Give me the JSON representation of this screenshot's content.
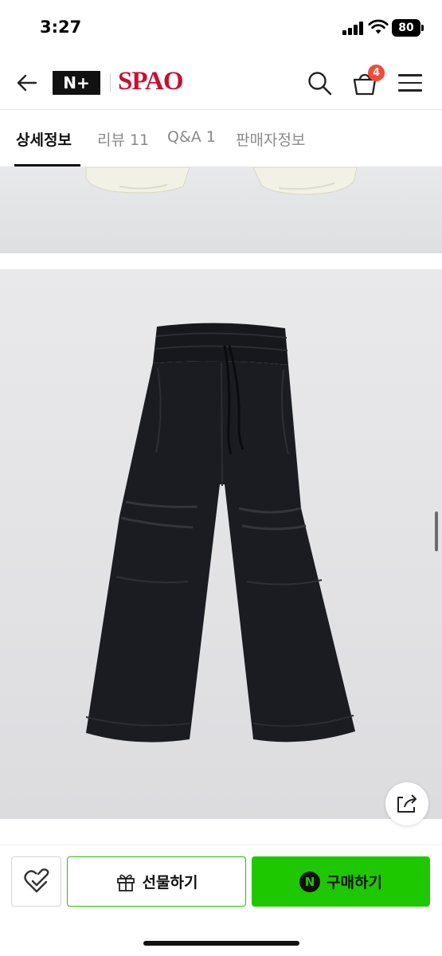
{
  "status_bar": {
    "time": "3:27",
    "battery": "80",
    "icons": [
      "signal-icon",
      "wifi-icon",
      "battery-icon"
    ]
  },
  "header": {
    "icons": [
      "back-arrow-icon",
      "search-icon",
      "shopping-bag-icon",
      "hamburger-menu-icon"
    ],
    "nplus_logo": "N+",
    "brand_logo": "SPAO",
    "cart_count": "4",
    "brand_color": "#c8102e",
    "badge_color": "#f04b3a"
  },
  "tabs": [
    {
      "label": "상세정보",
      "active": true
    },
    {
      "label": "리뷰 11",
      "active": false
    },
    {
      "label": "Q&A 1",
      "active": false
    },
    {
      "label": "판매자정보",
      "active": false
    }
  ],
  "product_images": [
    {
      "subject": "cream-pants-hem"
    },
    {
      "subject": "black-parachute-pants"
    }
  ],
  "floating": {
    "icon": "share-icon"
  },
  "bottom_bar": {
    "wish_icon": "heart-check-icon",
    "gift_icon": "gift-icon",
    "gift_label": "선물하기",
    "buy_icon": "naver-n-icon",
    "buy_badge": "N",
    "buy_label": "구매하기",
    "accent_color": "#1ec800"
  }
}
